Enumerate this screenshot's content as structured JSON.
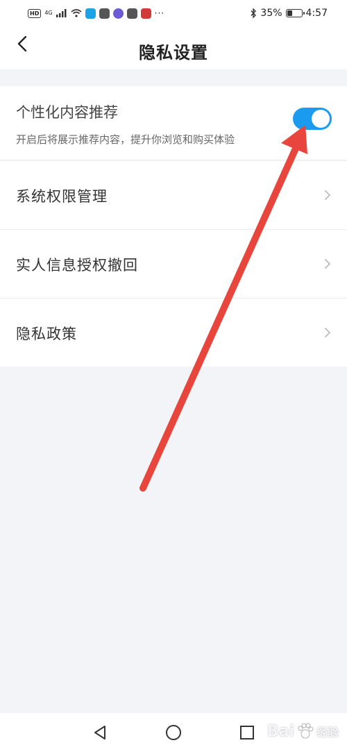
{
  "status_bar": {
    "network": "4G",
    "bluetooth": "bluetooth-icon",
    "battery_percent": "35%",
    "time": "4:57",
    "more": "···"
  },
  "header": {
    "title": "隐私设置",
    "back_icon": "chevron-left-icon"
  },
  "recommendation": {
    "label": "个性化内容推荐",
    "description": "开启后将展示推荐内容，提升你浏览和购买体验",
    "enabled": true,
    "toggle_color": "#1a9bf0"
  },
  "menu": [
    {
      "label": "系统权限管理"
    },
    {
      "label": "实人信息授权撤回"
    },
    {
      "label": "隐私政策"
    }
  ],
  "watermark": {
    "text": "Bai",
    "sub": "经验"
  },
  "annotation_color": "#e8453c"
}
